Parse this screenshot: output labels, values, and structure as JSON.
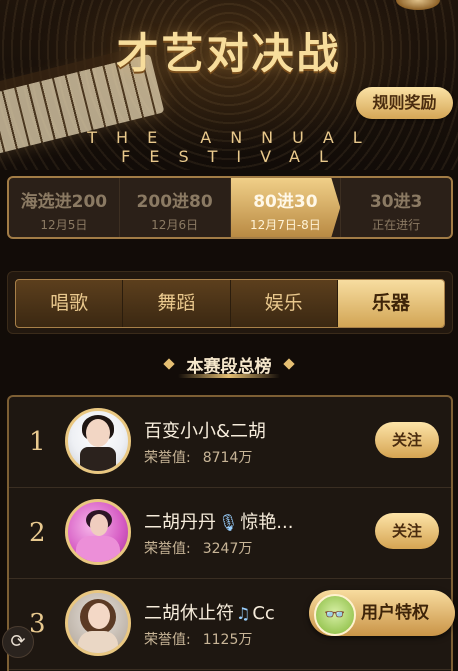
{
  "header": {
    "title": "才艺对决战",
    "subtitle": "THE ANNUAL FESTIVAL",
    "rules_button": "规则奖励"
  },
  "stages": [
    {
      "name": "海选进200",
      "date": "12月5日",
      "active": false
    },
    {
      "name": "200进80",
      "date": "12月6日",
      "active": false
    },
    {
      "name": "80进30",
      "date": "12月7日-8日",
      "active": true
    },
    {
      "name": "30进3",
      "date": "正在进行",
      "active": false
    }
  ],
  "categories": [
    {
      "label": "唱歌",
      "active": false
    },
    {
      "label": "舞蹈",
      "active": false
    },
    {
      "label": "娱乐",
      "active": false
    },
    {
      "label": "乐器",
      "active": true
    }
  ],
  "ranking": {
    "title": "本赛段总榜",
    "score_label": "荣誉值:",
    "follow_label": "关注",
    "rows": [
      {
        "rank": "1",
        "name": "百变小小&二胡",
        "score": "8714万",
        "avatar_icon": "avatar-erhu-player-icon"
      },
      {
        "rank": "2",
        "name_pre": "二胡丹丹",
        "name_icon": "microphone-icon",
        "name_post": "惊艳...",
        "score": "3247万",
        "avatar_icon": "avatar-pink-dress-icon"
      },
      {
        "rank": "3",
        "name_pre": "二胡休止符",
        "name_icon": "music-notes-icon",
        "name_post": "Cc",
        "score": "1125万",
        "avatar_icon": "avatar-woman-icon"
      }
    ]
  },
  "floating": {
    "privilege_label": "用户特权",
    "privilege_icon": "glasses-face-icon",
    "refresh_icon": "refresh-icon"
  },
  "colors": {
    "gold_light": "#f7dda0",
    "gold_dark": "#d2a555",
    "background": "#120c08"
  }
}
